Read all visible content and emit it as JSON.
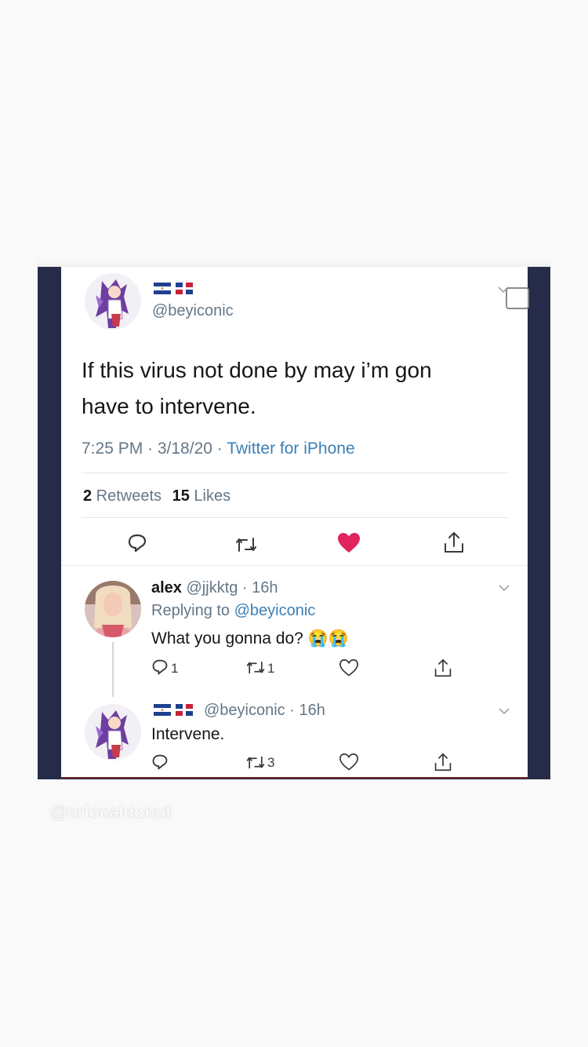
{
  "tweet": {
    "handle": "@beyiconic",
    "text_line1": "If this virus not done by may i’m gon",
    "text_line2": "have to intervene.",
    "time": "7:25 PM · 3/18/20 · ",
    "source": "Twitter for iPhone",
    "retweets_count": "2",
    "retweets_label": " Retweets",
    "likes_count": "15",
    "likes_label": " Likes",
    "liked": true
  },
  "replies": [
    {
      "name": "alex",
      "handle_time": "@jjkktg · 16h",
      "replying_prefix": "Replying to ",
      "replying_to": "@beyiconic",
      "text": "What you gonna do? 😭😭",
      "reply_count": "1",
      "retweet_count": "1",
      "like_count": ""
    },
    {
      "name": "",
      "handle_time": "@beyiconic · 16h",
      "text": "Intervene.",
      "reply_count": "",
      "retweet_count": "3",
      "like_count": ""
    }
  ],
  "watermark": "@urlocaldonut",
  "icons": {
    "reply": "reply-icon",
    "retweet": "retweet-icon",
    "like": "heart-icon",
    "share": "share-icon",
    "more": "chevron-down-icon"
  },
  "colors": {
    "frame": "#262b49",
    "like_active": "#e0245e",
    "link": "#3b7fb5",
    "muted": "#657786"
  }
}
